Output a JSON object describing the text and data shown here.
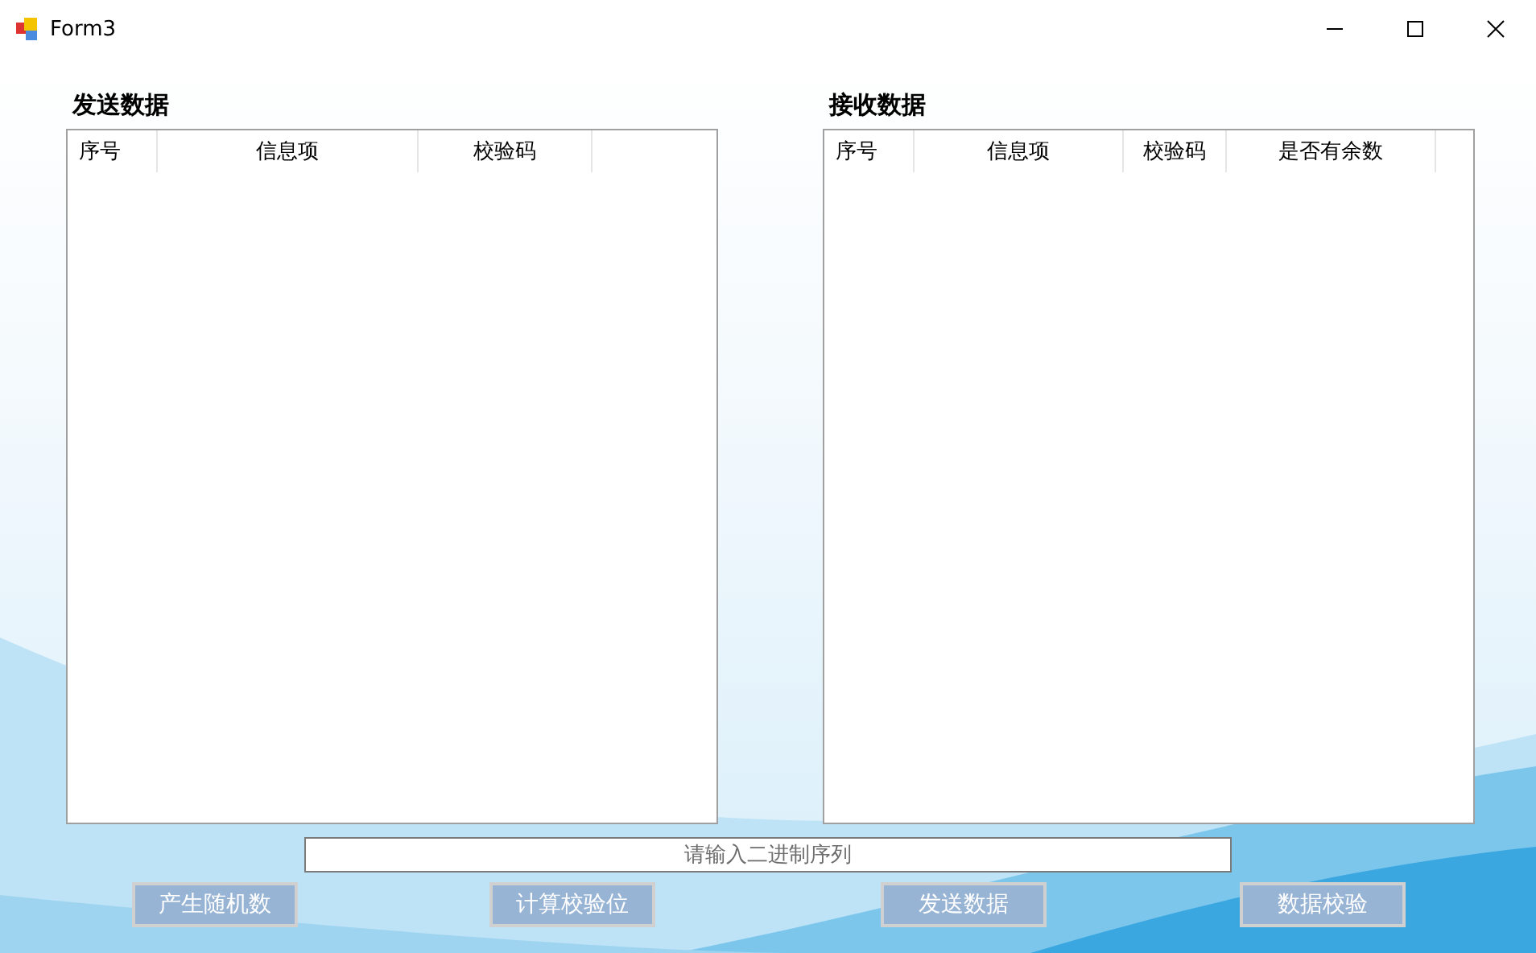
{
  "window": {
    "title": "Form3"
  },
  "panels": [
    {
      "title": "发送数据",
      "columns": [
        "序号",
        "信息项",
        "校验码"
      ]
    },
    {
      "title": "接收数据",
      "columns": [
        "序号",
        "信息项",
        "校验码",
        "是否有余数"
      ]
    }
  ],
  "input": {
    "placeholder": "请输入二进制序列"
  },
  "buttons": [
    "产生随机数",
    "计算校验位",
    "发送数据",
    "数据校验"
  ]
}
